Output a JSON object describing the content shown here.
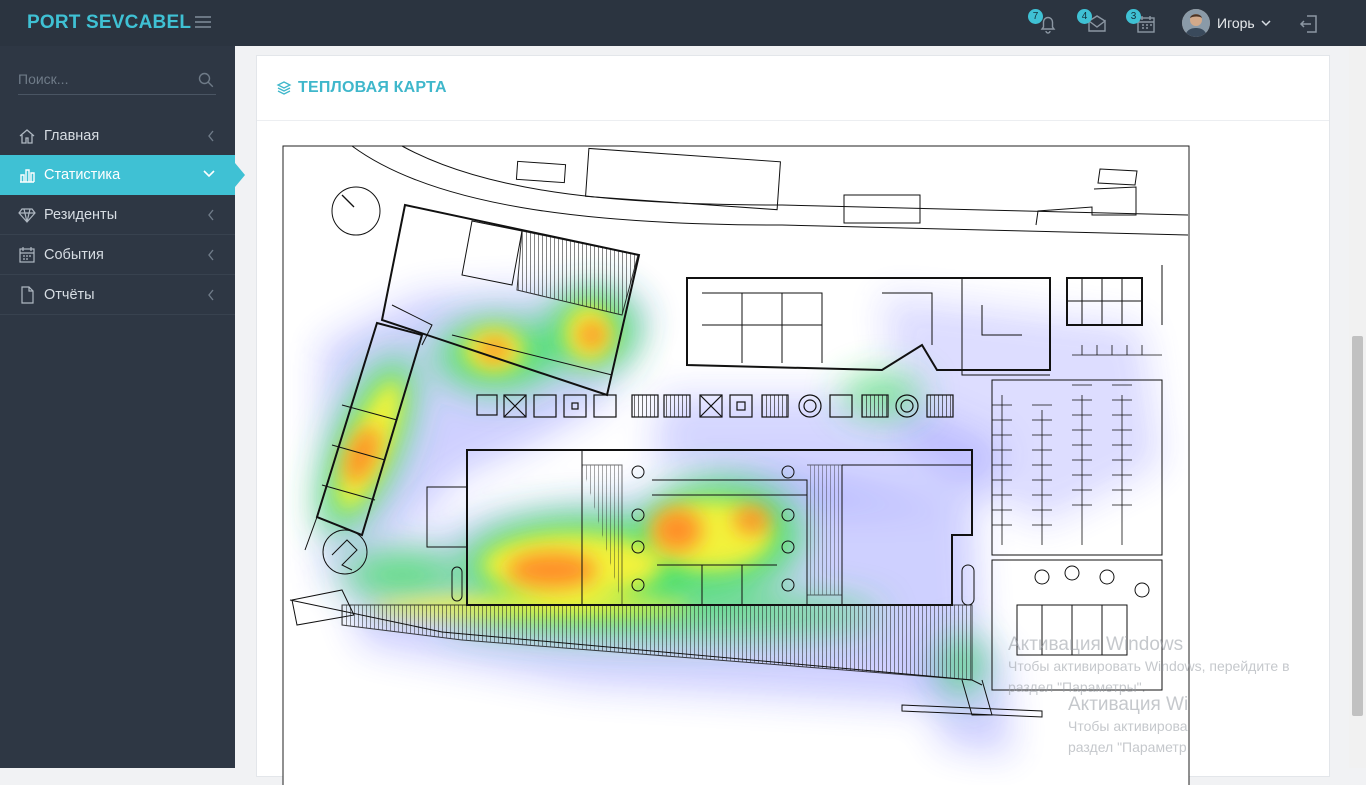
{
  "app": {
    "brand": "PORT SEVCABEL"
  },
  "topbar": {
    "notifications": {
      "icon": "bell-icon",
      "count": "7"
    },
    "messages": {
      "icon": "envelope-icon",
      "count": "4"
    },
    "calendar": {
      "icon": "calendar-icon",
      "count": "3"
    },
    "user": {
      "name": "Игорь"
    },
    "logout_icon": "logout-icon"
  },
  "sidebar": {
    "search": {
      "placeholder": "Поиск...",
      "value": ""
    },
    "items": [
      {
        "label": "Главная",
        "icon": "home-icon",
        "active": false
      },
      {
        "label": "Статистика",
        "icon": "bar-chart-icon",
        "active": true
      },
      {
        "label": "Резиденты",
        "icon": "diamond-icon",
        "active": false
      },
      {
        "label": "События",
        "icon": "calendar-icon",
        "active": false
      },
      {
        "label": "Отчёты",
        "icon": "document-icon",
        "active": false
      }
    ]
  },
  "main": {
    "panel_title": "ТЕПЛОВАЯ КАРТА",
    "panel_icon": "layers-icon"
  },
  "watermark": {
    "title": "Активация Windows",
    "line1": "Чтобы активировать Windows, перейдите в",
    "line2": "раздел \"Параметры\".",
    "title2": "Активация Wi",
    "line3": "Чтобы активирова",
    "line4": "раздел \"Параметр"
  },
  "colors": {
    "accent": "#3fc1d4",
    "topbar": "#2b3440",
    "sidebar": "#2e3744"
  }
}
